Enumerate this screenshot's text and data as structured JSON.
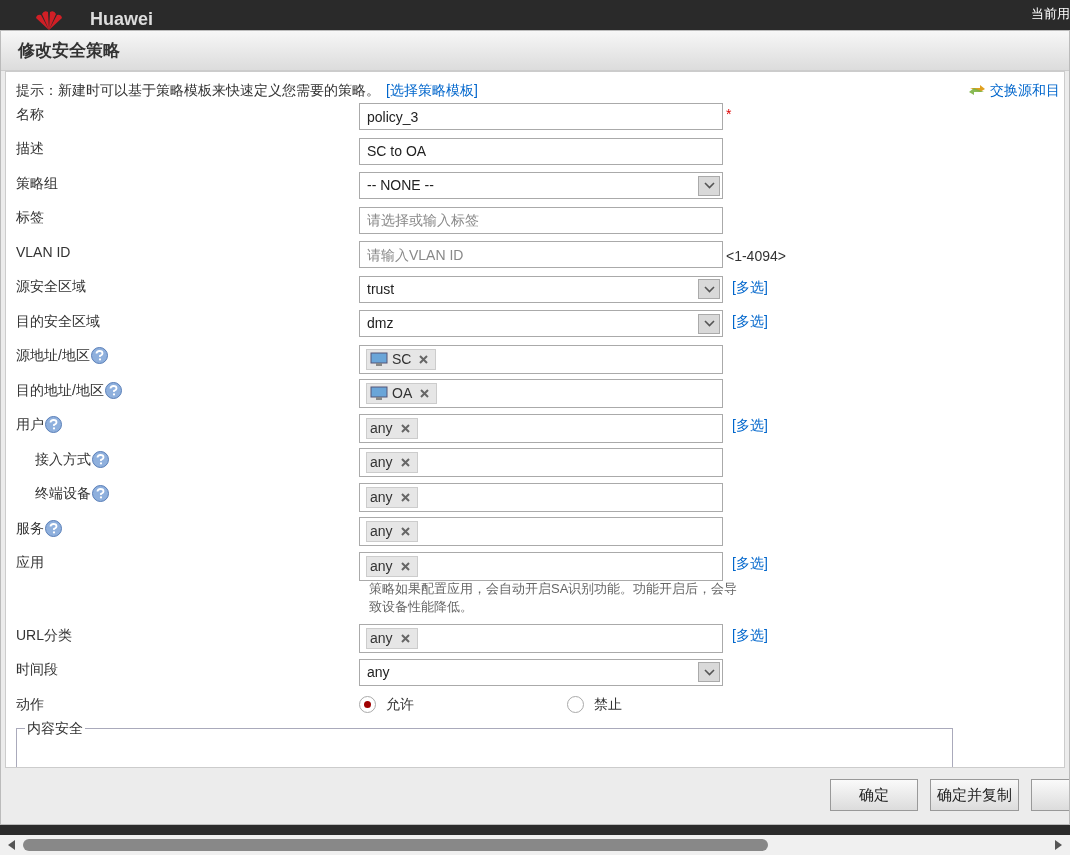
{
  "app_bar": {
    "brand": "Huawei",
    "user": "当前用"
  },
  "dialog": {
    "title": "修改安全策略",
    "hint": "提示：新建时可以基于策略模板来快速定义您需要的策略。",
    "hint_link": "[选择策略模板]",
    "swap_link": "交换源和目",
    "fields": [
      {
        "kind": "text",
        "label": "名称",
        "value": "policy_3",
        "required_mark": "*"
      },
      {
        "kind": "text",
        "label": "描述",
        "value": "SC to OA"
      },
      {
        "kind": "select",
        "label": "策略组",
        "value": "-- NONE --"
      },
      {
        "kind": "text",
        "label": "标签",
        "placeholder": "请选择或输入标签"
      },
      {
        "kind": "text",
        "label": "VLAN ID",
        "placeholder": "请输入VLAN ID",
        "suffix": "<1-4094>"
      },
      {
        "kind": "select",
        "label": "源安全区域",
        "value": "trust",
        "link": "[多选]"
      },
      {
        "kind": "select",
        "label": "目的安全区域",
        "value": "dmz",
        "link": "[多选]"
      },
      {
        "kind": "tags",
        "label": "源地址/地区",
        "help": true,
        "tags": [
          {
            "text": "SC",
            "icon": true
          }
        ]
      },
      {
        "kind": "tags",
        "label": "目的地址/地区",
        "help": true,
        "tags": [
          {
            "text": "OA",
            "icon": true
          }
        ]
      },
      {
        "kind": "tags",
        "label": "用户",
        "help": true,
        "tags": [
          {
            "text": "any",
            "icon": false
          }
        ],
        "link": "[多选]"
      },
      {
        "kind": "tags",
        "label": "接入方式",
        "help": true,
        "indent": true,
        "tags": [
          {
            "text": "any",
            "icon": false
          }
        ]
      },
      {
        "kind": "tags",
        "label": "终端设备",
        "help": true,
        "indent": true,
        "tags": [
          {
            "text": "any",
            "icon": false
          }
        ]
      },
      {
        "kind": "tags",
        "label": "服务",
        "help": true,
        "tags": [
          {
            "text": "any",
            "icon": false
          }
        ]
      },
      {
        "kind": "tags",
        "label": "应用",
        "tags": [
          {
            "text": "any",
            "icon": false
          }
        ],
        "link": "[多选]",
        "note": "策略如果配置应用，会自动开启SA识别功能。功能开启后，会导致设备性能降低。"
      },
      {
        "kind": "tags",
        "label": "URL分类",
        "tags": [
          {
            "text": "any",
            "icon": false
          }
        ],
        "link": "[多选]"
      },
      {
        "kind": "select",
        "label": "时间段",
        "value": "any"
      },
      {
        "kind": "radio",
        "label": "动作",
        "options": [
          {
            "label": "允许",
            "selected": true
          },
          {
            "label": "禁止",
            "selected": false
          }
        ]
      }
    ],
    "section": "内容安全",
    "buttons": [
      "确定",
      "确定并复制"
    ]
  }
}
